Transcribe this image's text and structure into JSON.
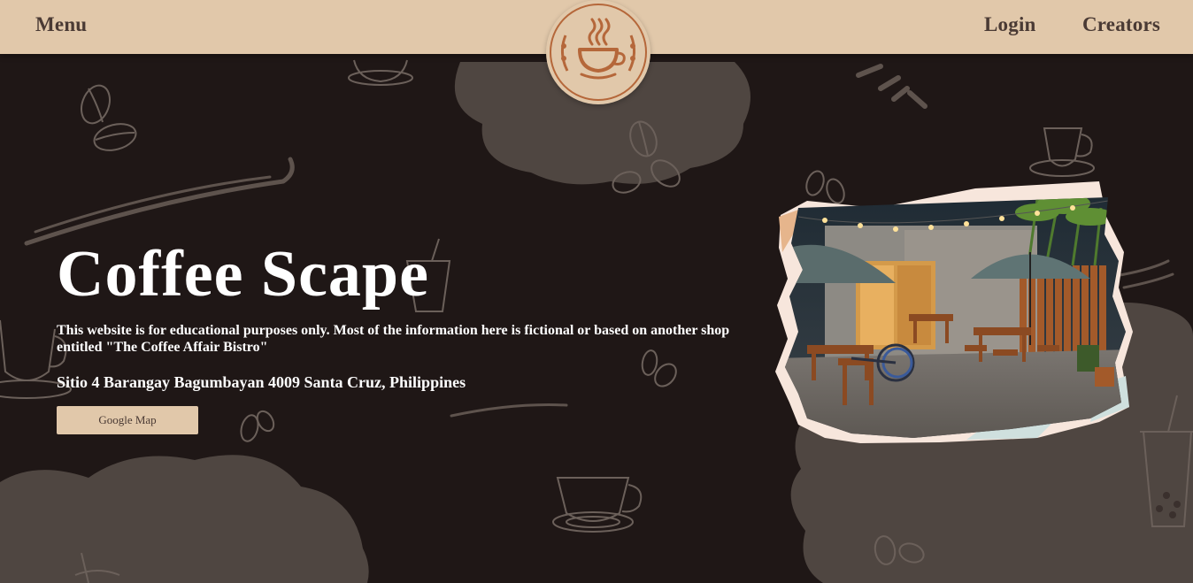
{
  "header": {
    "menu_label": "Menu",
    "login_label": "Login",
    "creators_label": "Creators",
    "logo_icon": "coffee-cup-logo-icon"
  },
  "hero": {
    "title": "Coffee Scape",
    "description": "This website is for educational purposes only. Most of the information here is fictional or based on another shop entitled \"The Coffee Affair Bistro\"",
    "address": "Sitio 4 Barangay Bagumbayan 4009 Santa Cruz, Philippines",
    "map_button_label": "Google Map",
    "photo_icon": "cafe-outdoor-photo"
  },
  "colors": {
    "background": "#1f1716",
    "header": "#e1c8aa",
    "cloud": "#4f4641",
    "accent": "#b5673a",
    "text_dark": "#4a3a34",
    "text_light": "#ffffff"
  }
}
